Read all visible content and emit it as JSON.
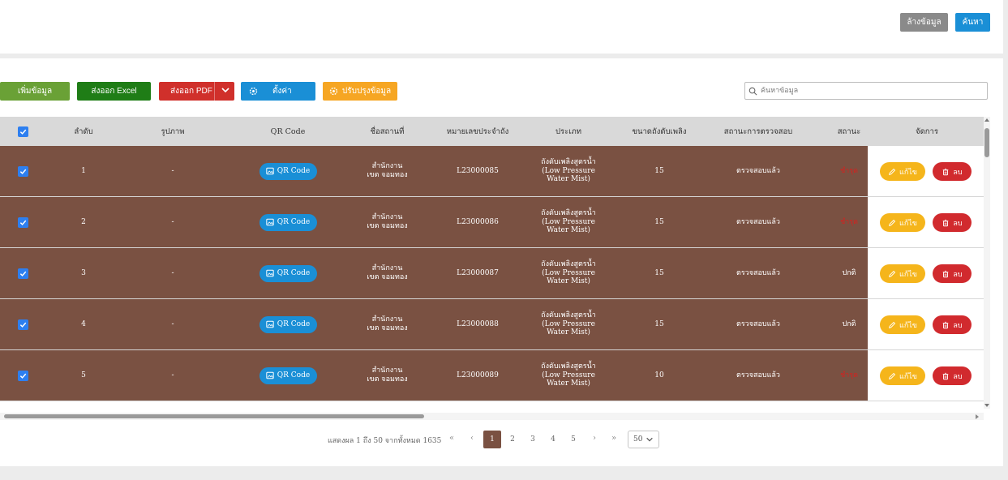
{
  "filter_panel": {
    "clear_label": "ล้างข้อมูล",
    "search_label": "ค้นหา"
  },
  "toolbar": {
    "add_label": "เพิ่มข้อมูล",
    "excel_label": "ส่งออก Excel",
    "pdf_label": "ส่งออก PDF",
    "settings_label": "ตั้งค่า",
    "update_label": "ปรับปรุงข้อมูล",
    "search_placeholder": "ค้นหาข้อมูล"
  },
  "table": {
    "columns": [
      "ลำดับ",
      "รูปภาพ",
      "QR Code",
      "ชื่อสถานที่",
      "หมายเลขประจำถัง",
      "ประเภท",
      "ขนาดถังดับเพลิง",
      "สถานะการตรวจสอบ",
      "สถานะ",
      "จัดการ"
    ],
    "qr_label": "QR Code",
    "edit_label": "แก้ไข",
    "delete_label": "ลบ",
    "rows": [
      {
        "no": "1",
        "image": "-",
        "place": "สำนักงานเขต จอมทอง",
        "serial": "L23000085",
        "type": "ถังดับเพลิงสูตรน้ำ (Low Pressure Water Mist)",
        "size": "15",
        "inspection": "ตรวจสอบแล้ว",
        "status": "ชำรุด",
        "status_color": "#d8201e",
        "checked": true
      },
      {
        "no": "2",
        "image": "-",
        "place": "สำนักงานเขต จอมทอง",
        "serial": "L23000086",
        "type": "ถังดับเพลิงสูตรน้ำ (Low Pressure Water Mist)",
        "size": "15",
        "inspection": "ตรวจสอบแล้ว",
        "status": "ชำรุด",
        "status_color": "#d8201e",
        "checked": true
      },
      {
        "no": "3",
        "image": "-",
        "place": "สำนักงานเขต จอมทอง",
        "serial": "L23000087",
        "type": "ถังดับเพลิงสูตรน้ำ (Low Pressure Water Mist)",
        "size": "15",
        "inspection": "ตรวจสอบแล้ว",
        "status": "ปกติ",
        "status_color": "#ffffff",
        "checked": true
      },
      {
        "no": "4",
        "image": "-",
        "place": "สำนักงานเขต จอมทอง",
        "serial": "L23000088",
        "type": "ถังดับเพลิงสูตรน้ำ (Low Pressure Water Mist)",
        "size": "15",
        "inspection": "ตรวจสอบแล้ว",
        "status": "ปกติ",
        "status_color": "#ffffff",
        "checked": true
      },
      {
        "no": "5",
        "image": "-",
        "place": "สำนักงานเขต จอมทอง",
        "serial": "L23000089",
        "type": "ถังดับเพลิงสูตรน้ำ (Low Pressure Water Mist)",
        "size": "10",
        "inspection": "ตรวจสอบแล้ว",
        "status": "ชำรุด",
        "status_color": "#d8201e",
        "checked": true
      }
    ]
  },
  "pagination": {
    "info": "แสดงผล 1 ถึง 50 จากทั้งหมด 1635",
    "first": "«",
    "prev": "‹",
    "pages": [
      "1",
      "2",
      "3",
      "4",
      "5"
    ],
    "current_page": "1",
    "next": "›",
    "last": "»",
    "page_size": "50"
  },
  "colors": {
    "row_selected": "#7a5142",
    "primary": "#1a8fd6",
    "success": "#1f7d16",
    "danger": "#d12a2e",
    "warning": "#f5b51b"
  }
}
